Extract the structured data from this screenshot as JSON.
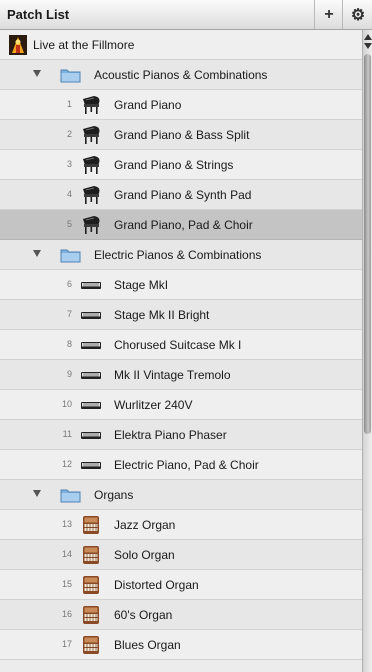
{
  "header": {
    "title": "Patch List",
    "add_label": "+",
    "gear_label": "⚙",
    "gear_icon": "gear-icon"
  },
  "list": {
    "items": [
      {
        "kind": "root",
        "label": "Live at the Fillmore",
        "icon": "concert-icon"
      },
      {
        "kind": "folder",
        "label": "Acoustic Pianos & Combinations",
        "icon": "folder-icon",
        "expanded": true
      },
      {
        "kind": "patch",
        "number": "1",
        "label": "Grand Piano",
        "icon": "grand-piano-icon"
      },
      {
        "kind": "patch",
        "number": "2",
        "label": "Grand Piano & Bass Split",
        "icon": "grand-piano-icon"
      },
      {
        "kind": "patch",
        "number": "3",
        "label": "Grand Piano & Strings",
        "icon": "grand-piano-icon"
      },
      {
        "kind": "patch",
        "number": "4",
        "label": "Grand Piano & Synth Pad",
        "icon": "grand-piano-icon"
      },
      {
        "kind": "patch",
        "number": "5",
        "label": "Grand Piano, Pad & Choir",
        "icon": "grand-piano-icon",
        "selected": true
      },
      {
        "kind": "folder",
        "label": "Electric Pianos & Combinations",
        "icon": "folder-icon",
        "expanded": true
      },
      {
        "kind": "patch",
        "number": "6",
        "label": "Stage MkI",
        "icon": "electric-piano-icon"
      },
      {
        "kind": "patch",
        "number": "7",
        "label": "Stage Mk II Bright",
        "icon": "electric-piano-icon"
      },
      {
        "kind": "patch",
        "number": "8",
        "label": "Chorused Suitcase Mk I",
        "icon": "electric-piano-icon"
      },
      {
        "kind": "patch",
        "number": "9",
        "label": "Mk II Vintage Tremolo",
        "icon": "electric-piano-icon"
      },
      {
        "kind": "patch",
        "number": "10",
        "label": "Wurlitzer 240V",
        "icon": "electric-piano-icon"
      },
      {
        "kind": "patch",
        "number": "11",
        "label": "Elektra Piano Phaser",
        "icon": "electric-piano-icon"
      },
      {
        "kind": "patch",
        "number": "12",
        "label": "Electric Piano, Pad & Choir",
        "icon": "electric-piano-icon"
      },
      {
        "kind": "folder",
        "label": "Organs",
        "icon": "folder-icon",
        "expanded": true
      },
      {
        "kind": "patch",
        "number": "13",
        "label": "Jazz Organ",
        "icon": "organ-icon"
      },
      {
        "kind": "patch",
        "number": "14",
        "label": "Solo Organ",
        "icon": "organ-icon"
      },
      {
        "kind": "patch",
        "number": "15",
        "label": "Distorted Organ",
        "icon": "organ-icon"
      },
      {
        "kind": "patch",
        "number": "16",
        "label": "60's Organ",
        "icon": "organ-icon"
      },
      {
        "kind": "patch",
        "number": "17",
        "label": "Blues Organ",
        "icon": "organ-icon"
      }
    ]
  },
  "colors": {
    "selected_row": "#c4c4c4",
    "folder_blue": "#6ea6d8",
    "organ_wood": "#8b4a26"
  }
}
